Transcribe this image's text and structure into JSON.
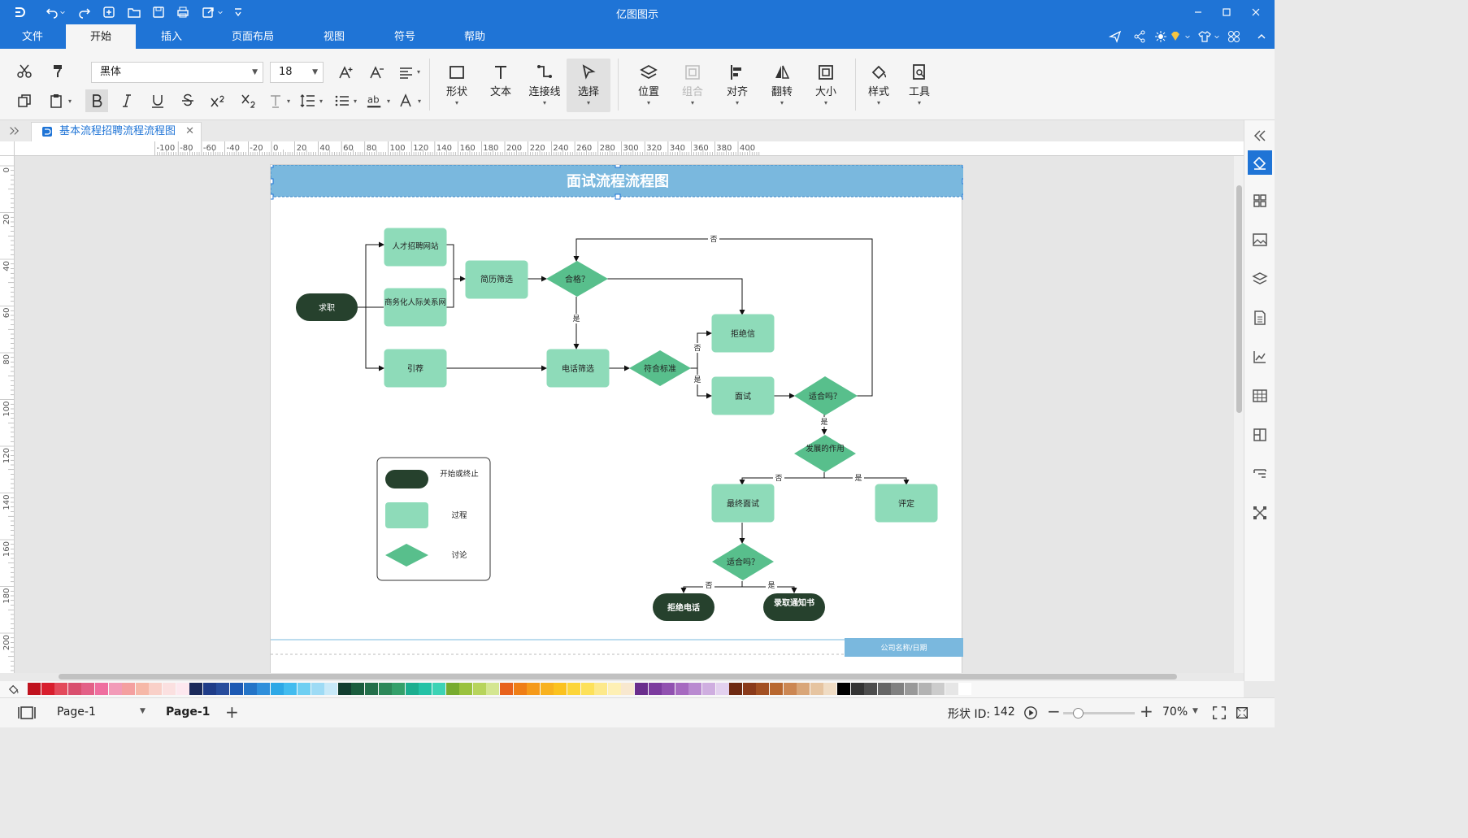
{
  "app": {
    "title": "亿图图示"
  },
  "menu": {
    "tabs": [
      "文件",
      "开始",
      "插入",
      "页面布局",
      "视图",
      "符号",
      "帮助"
    ],
    "active": "开始"
  },
  "ribbon": {
    "font_name": "黑体",
    "font_size": "18",
    "big_buttons": {
      "shape": "形状",
      "text": "文本",
      "connector": "连接线",
      "select": "选择",
      "position": "位置",
      "group": "组合",
      "align": "对齐",
      "flip": "翻转",
      "size": "大小",
      "style": "样式",
      "tools": "工具"
    }
  },
  "document": {
    "tab_title": "基本流程招聘流程流程图"
  },
  "ruler": {
    "h_ticks": [
      "-100",
      "-80",
      "-60",
      "-40",
      "-20",
      "0",
      "20",
      "40",
      "60",
      "80",
      "100",
      "120",
      "140",
      "160",
      "180",
      "200",
      "220",
      "240",
      "260",
      "280",
      "300",
      "320",
      "340",
      "360",
      "380",
      "400"
    ],
    "v_ticks": [
      "0",
      "20",
      "40",
      "60",
      "80",
      "100",
      "120",
      "140",
      "160",
      "180",
      "200"
    ]
  },
  "diagram": {
    "title": "面试流程流程图",
    "nodes": {
      "apply": "求职",
      "site": "人才招聘网站",
      "network": "商务化人际关系网",
      "referral": "引荐",
      "screen": "简历筛选",
      "qualified": "合格？",
      "phone": "电话筛选",
      "meets": "符合标准",
      "reject_letter": "拒绝信",
      "interview": "面试",
      "fit1": "适合吗？",
      "develop": "发展的作用",
      "final": "最终面试",
      "evaluate": "评定",
      "fit2": "适合吗？",
      "reject_call": "拒绝电话",
      "offer": "录取通知书"
    },
    "edge_labels": {
      "no": "否",
      "yes": "是"
    },
    "legend": {
      "start_end": "开始或终止",
      "process": "过程",
      "decision": "讨论"
    },
    "footer": "公司名称/日期",
    "colors": {
      "title_band": "#7ab8de",
      "terminal": "#26412d",
      "process": "#8edbb9",
      "decision": "#58bf8c",
      "footer": "#7ab8de"
    }
  },
  "status": {
    "page_selector": "Page-1",
    "page_tab": "Page-1",
    "shape_id_label": "形状 ID:",
    "shape_id": "142",
    "zoom": "70%"
  }
}
